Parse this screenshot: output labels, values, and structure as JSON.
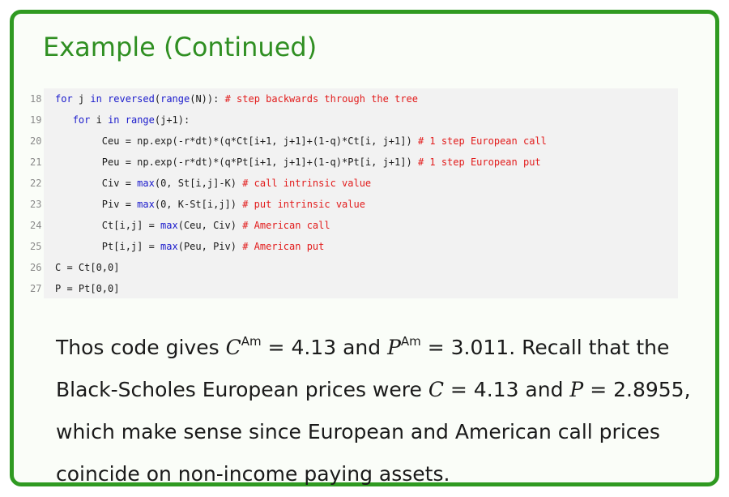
{
  "slide": {
    "title": "Example (Continued)"
  },
  "code": {
    "lines": [
      {
        "n": "18",
        "indent": "",
        "parts": [
          {
            "t": "for",
            "k": "kw"
          },
          {
            "t": " j ",
            "k": "tx"
          },
          {
            "t": "in",
            "k": "kw"
          },
          {
            "t": " ",
            "k": "tx"
          },
          {
            "t": "reversed",
            "k": "fn"
          },
          {
            "t": "(",
            "k": "tx"
          },
          {
            "t": "range",
            "k": "fn"
          },
          {
            "t": "(N)): ",
            "k": "tx"
          },
          {
            "t": "# step backwards through the tree",
            "k": "cm"
          }
        ]
      },
      {
        "n": "19",
        "indent": "   ",
        "parts": [
          {
            "t": "for",
            "k": "kw"
          },
          {
            "t": " i ",
            "k": "tx"
          },
          {
            "t": "in",
            "k": "kw"
          },
          {
            "t": " ",
            "k": "tx"
          },
          {
            "t": "range",
            "k": "fn"
          },
          {
            "t": "(j+1):",
            "k": "tx"
          }
        ]
      },
      {
        "n": "20",
        "indent": "        ",
        "parts": [
          {
            "t": "Ceu = np.exp(-r*dt)*(q*Ct[i+1, j+1]+(1-q)*Ct[i, j+1]) ",
            "k": "tx"
          },
          {
            "t": "# 1 step European call",
            "k": "cm"
          }
        ]
      },
      {
        "n": "21",
        "indent": "        ",
        "parts": [
          {
            "t": "Peu = np.exp(-r*dt)*(q*Pt[i+1, j+1]+(1-q)*Pt[i, j+1]) ",
            "k": "tx"
          },
          {
            "t": "# 1 step European put",
            "k": "cm"
          }
        ]
      },
      {
        "n": "22",
        "indent": "        ",
        "parts": [
          {
            "t": "Civ = ",
            "k": "tx"
          },
          {
            "t": "max",
            "k": "fn"
          },
          {
            "t": "(0, St[i,j]-K) ",
            "k": "tx"
          },
          {
            "t": "# call intrinsic value",
            "k": "cm"
          }
        ]
      },
      {
        "n": "23",
        "indent": "        ",
        "parts": [
          {
            "t": "Piv = ",
            "k": "tx"
          },
          {
            "t": "max",
            "k": "fn"
          },
          {
            "t": "(0, K-St[i,j]) ",
            "k": "tx"
          },
          {
            "t": "# put intrinsic value",
            "k": "cm"
          }
        ]
      },
      {
        "n": "24",
        "indent": "        ",
        "parts": [
          {
            "t": "Ct[i,j] = ",
            "k": "tx"
          },
          {
            "t": "max",
            "k": "fn"
          },
          {
            "t": "(Ceu, Civ) ",
            "k": "tx"
          },
          {
            "t": "# American call",
            "k": "cm"
          }
        ]
      },
      {
        "n": "25",
        "indent": "        ",
        "parts": [
          {
            "t": "Pt[i,j] = ",
            "k": "tx"
          },
          {
            "t": "max",
            "k": "fn"
          },
          {
            "t": "(Peu, Piv) ",
            "k": "tx"
          },
          {
            "t": "# American put",
            "k": "cm"
          }
        ]
      },
      {
        "n": "26",
        "indent": "",
        "parts": [
          {
            "t": "C = Ct[0,0]",
            "k": "tx"
          }
        ]
      },
      {
        "n": "27",
        "indent": "",
        "parts": [
          {
            "t": "P = Pt[0,0]",
            "k": "tx"
          }
        ]
      }
    ]
  },
  "text": {
    "l1_a": "Thos code gives ",
    "C": "C",
    "sup_am": "Am",
    "eq_413": " = 4.13",
    "and": " and ",
    "P": "P",
    "eq_3011": " = 3.011",
    "l1_b": ". Recall that the",
    "l2_a": "Black-Scholes European prices were ",
    "eq_413b": " = 4.13",
    "and2": " and ",
    "eq_28955": " = 2.8955",
    "l2_b": ",",
    "l3": "which make sense since European and American call prices",
    "l4": "coincide on non-income paying assets."
  }
}
